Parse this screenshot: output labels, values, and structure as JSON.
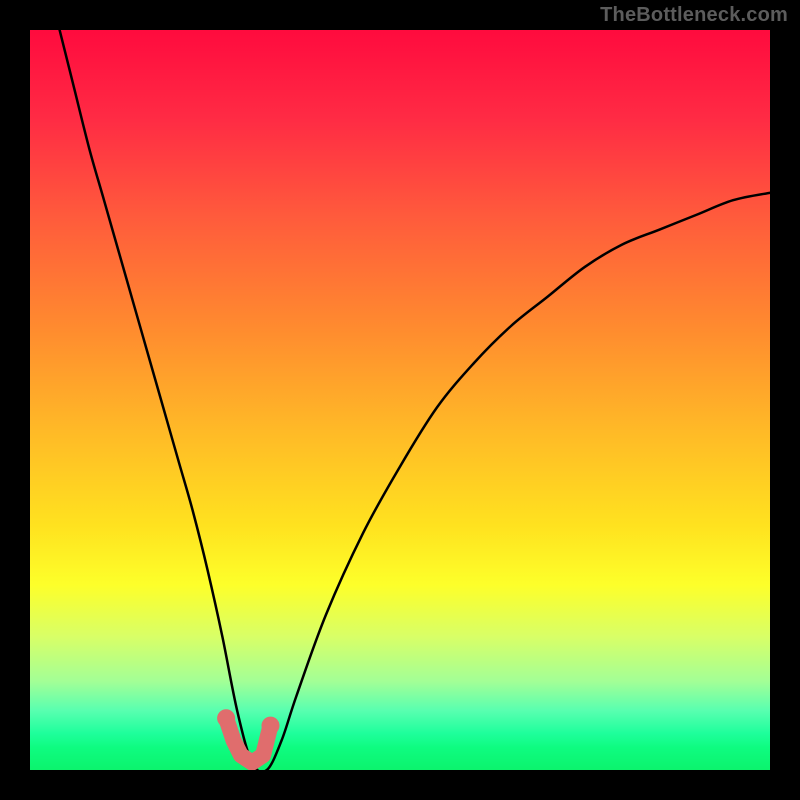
{
  "watermark": "TheBottleneck.com",
  "colors": {
    "background": "#000000",
    "gradient_top": "#ff0b3e",
    "gradient_bottom": "#0cf36d",
    "curve": "#000000",
    "markers": "#e06d6d"
  },
  "chart_data": {
    "type": "line",
    "title": "",
    "xlabel": "",
    "ylabel": "",
    "xlim": [
      0,
      100
    ],
    "ylim": [
      0,
      100
    ],
    "grid": false,
    "legend": false,
    "notes": "Bottleneck-style curve: y is bottleneck percentage (0 at trough, 100 at top). Minimum near x≈28–32. Background gradient encodes y: red=high, green=low.",
    "series": [
      {
        "name": "bottleneck-curve",
        "x": [
          4,
          6,
          8,
          10,
          12,
          14,
          16,
          18,
          20,
          22,
          24,
          26,
          28,
          30,
          32,
          34,
          36,
          40,
          45,
          50,
          55,
          60,
          65,
          70,
          75,
          80,
          85,
          90,
          95,
          100
        ],
        "values": [
          100,
          92,
          84,
          77,
          70,
          63,
          56,
          49,
          42,
          35,
          27,
          18,
          8,
          1,
          0,
          4,
          10,
          21,
          32,
          41,
          49,
          55,
          60,
          64,
          68,
          71,
          73,
          75,
          77,
          78
        ]
      }
    ],
    "markers": {
      "name": "trough-markers",
      "x": [
        26.5,
        27.5,
        28.5,
        30,
        31.5,
        32.5
      ],
      "values": [
        7,
        4,
        2,
        1,
        2,
        6
      ]
    }
  }
}
